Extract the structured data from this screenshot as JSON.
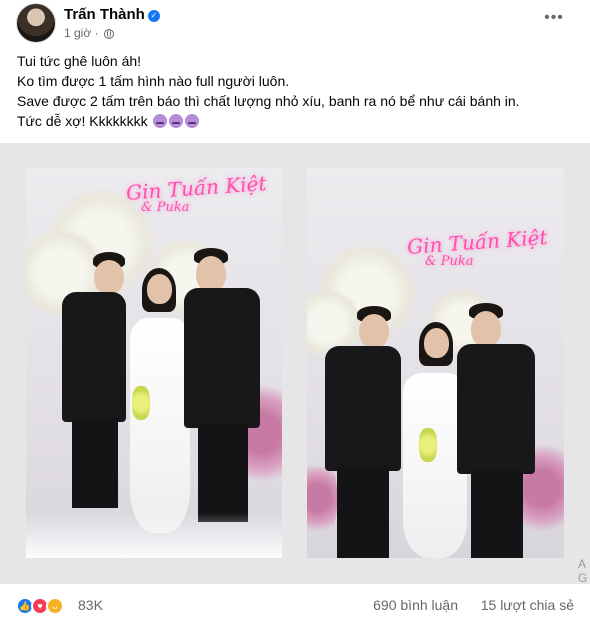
{
  "post": {
    "author": "Trấn Thành",
    "time": "1 giờ",
    "more_label": "•••",
    "verified_icon": "verified-badge-icon",
    "privacy_icon": "globe-icon",
    "text_lines": [
      "Tui tức ghê luôn áh!",
      "Ko tìm được 1 tấm hình nào full người luôn.",
      "Save được 2 tấm trên báo thì chất lượng nhỏ xíu, banh ra nó bể như cái bánh in.",
      "Tức dễ xợ! Kkkkkkkk"
    ],
    "trailing_emojis": [
      "dizzy-face-emoji",
      "dizzy-face-emoji",
      "dizzy-face-emoji"
    ]
  },
  "photos": [
    {
      "neon_line1": "Gin Tuấn Kiệt",
      "neon_line2": "& Puka"
    },
    {
      "neon_line1": "Gin Tuấn Kiệt",
      "neon_line2": "& Puka"
    }
  ],
  "side_text": {
    "line1": "A",
    "line2": "G"
  },
  "stats": {
    "reaction_icons": [
      "like-icon",
      "love-icon",
      "haha-icon"
    ],
    "reaction_count": "83K",
    "comments": "690 bình luận",
    "shares": "15 lượt chia sẻ"
  },
  "colors": {
    "like": "#1877f2",
    "love": "#f33e58",
    "haha": "#f7b125",
    "verified": "#1877f2",
    "meta": "#65676b"
  }
}
